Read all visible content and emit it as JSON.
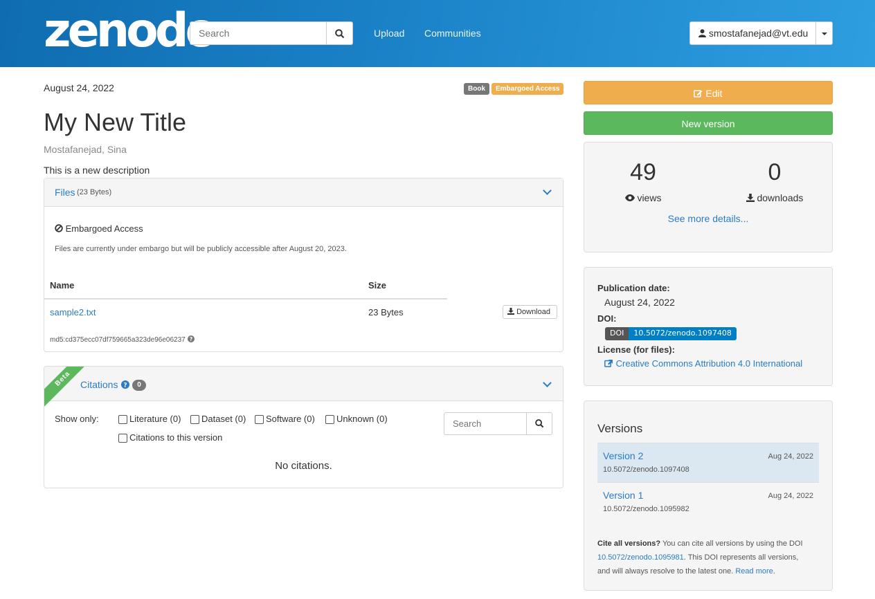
{
  "header": {
    "logo": "zenodo",
    "search_placeholder": "Search",
    "upload": "Upload",
    "communities": "Communities",
    "user": "smostafanejad@vt.edu"
  },
  "record": {
    "date": "August 24, 2022",
    "badge_type": "Book",
    "badge_access": "Embargoed Access",
    "title": "My New Title",
    "author": "Mostafanejad, Sina",
    "description": "This is a new description"
  },
  "files": {
    "heading": "Files",
    "size_note": "(23 Bytes)",
    "embargo_title": "Embargoed Access",
    "embargo_text": "Files are currently under embargo but will be publicly accessible after August 20, 2023.",
    "col_name": "Name",
    "col_size": "Size",
    "file_name": "sample2.txt",
    "file_size": "23 Bytes",
    "download": "Download",
    "md5": "md5:cd375ecc07df759665a323de96e06237"
  },
  "citations": {
    "ribbon": "Beta",
    "heading": "Citations",
    "count": "0",
    "show_only": "Show only:",
    "filters": [
      "Literature (0)",
      "Dataset (0)",
      "Software (0)",
      "Unknown (0)"
    ],
    "this_version": "Citations to this version",
    "search_placeholder": "Search",
    "empty": "No citations."
  },
  "sidebar": {
    "edit": "Edit",
    "new_version": "New version",
    "views_count": "49",
    "views_label": "views",
    "downloads_count": "0",
    "downloads_label": "downloads",
    "more": "See more details...",
    "pub_label": "Publication date:",
    "pub_value": "August 24, 2022",
    "doi_label": "DOI:",
    "doi_prefix": "DOI",
    "doi_value": "10.5072/zenodo.1097408",
    "license_label": "License (for files):",
    "license_value": "Creative Commons Attribution 4.0 International"
  },
  "versions": {
    "heading": "Versions",
    "items": [
      {
        "name": "Version 2",
        "doi": "10.5072/zenodo.1097408",
        "date": "Aug 24, 2022"
      },
      {
        "name": "Version 1",
        "doi": "10.5072/zenodo.1095982",
        "date": "Aug 24, 2022"
      }
    ],
    "cite_bold": "Cite all versions?",
    "cite_text1": "You can cite all versions by using the DOI",
    "cite_doi": "10.5072/zenodo.1095981",
    "cite_text2": ". This DOI represents all versions,",
    "cite_text3": "and will always resolve to the latest one.",
    "read_more": "Read more",
    "period": "."
  },
  "colors": {
    "header": "#1b82c8",
    "edit": "#f0ad4e",
    "new_version": "#5cb85c",
    "label_default": "#777777",
    "label_warning": "#f0ad4e",
    "ribbon": "#5cb85c"
  }
}
